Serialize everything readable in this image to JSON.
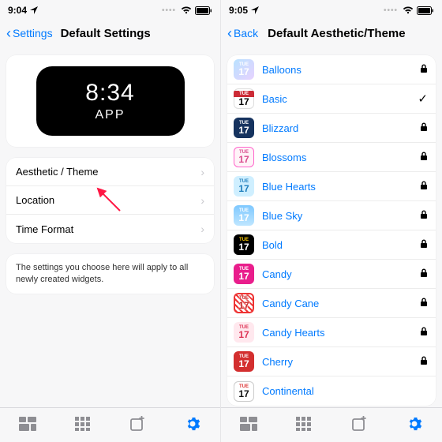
{
  "left": {
    "status_time": "9:04",
    "nav_back": "Settings",
    "nav_title": "Default Settings",
    "widget_time": "8:34",
    "widget_label": "APP",
    "rows": {
      "aesthetic": "Aesthetic / Theme",
      "location": "Location",
      "timeformat": "Time Format"
    },
    "note": "The settings you choose here will apply to all newly created widgets."
  },
  "right": {
    "status_time": "9:05",
    "nav_back": "Back",
    "nav_title": "Default Aesthetic/Theme",
    "icon_dow": "TUE",
    "icon_dom": "17",
    "themes": [
      {
        "name": "Balloons",
        "cls": "ic-balloons",
        "locked": true,
        "selected": false
      },
      {
        "name": "Basic",
        "cls": "ic-basic",
        "locked": false,
        "selected": true
      },
      {
        "name": "Blizzard",
        "cls": "ic-blizzard",
        "locked": true,
        "selected": false
      },
      {
        "name": "Blossoms",
        "cls": "ic-blossoms",
        "locked": true,
        "selected": false
      },
      {
        "name": "Blue Hearts",
        "cls": "ic-bluehearts",
        "locked": true,
        "selected": false
      },
      {
        "name": "Blue Sky",
        "cls": "ic-bluesky",
        "locked": true,
        "selected": false
      },
      {
        "name": "Bold",
        "cls": "ic-bold",
        "locked": true,
        "selected": false
      },
      {
        "name": "Candy",
        "cls": "ic-candy",
        "locked": true,
        "selected": false
      },
      {
        "name": "Candy Cane",
        "cls": "ic-candycane",
        "locked": true,
        "selected": false
      },
      {
        "name": "Candy Hearts",
        "cls": "ic-candyhearts",
        "locked": true,
        "selected": false
      },
      {
        "name": "Cherry",
        "cls": "ic-cherry",
        "locked": true,
        "selected": false
      },
      {
        "name": "Continental",
        "cls": "ic-continental",
        "locked": false,
        "selected": false
      }
    ]
  }
}
